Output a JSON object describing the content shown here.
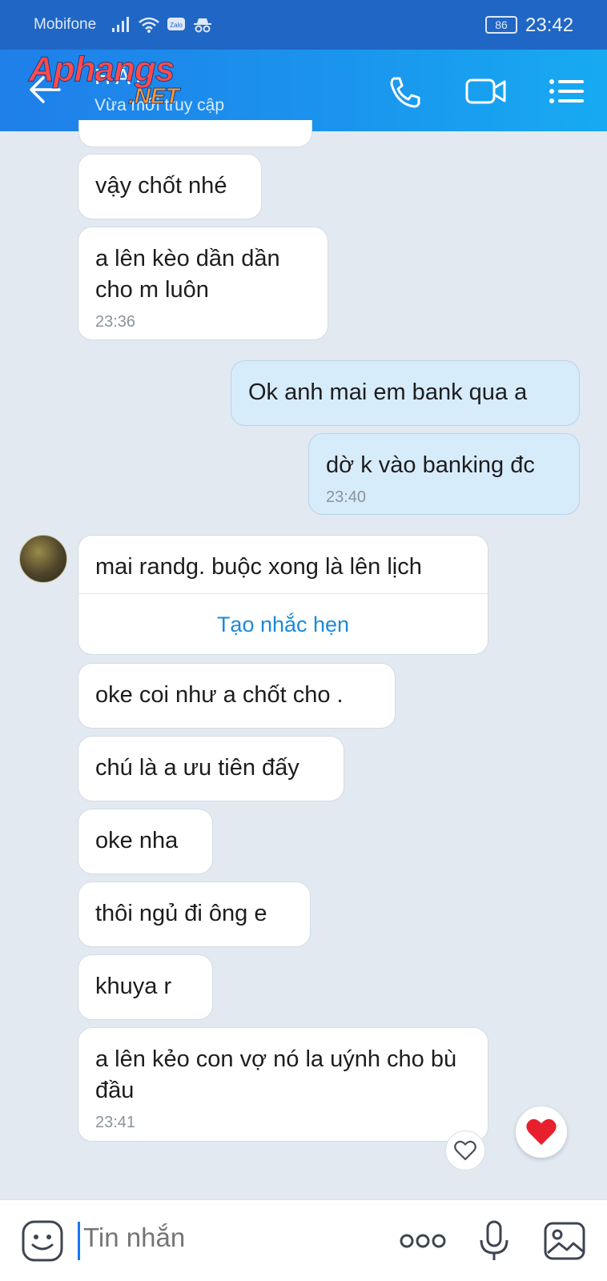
{
  "status_bar": {
    "carrier": "Mobifone",
    "battery": "86",
    "time": "23:42",
    "icons": [
      "signal-icon",
      "wifi-icon",
      "zalo-icon",
      "incognito-icon"
    ],
    "zalo_badge": "Zalo"
  },
  "header": {
    "contact_name": "HẢI",
    "status": "Vừa mới truy cập",
    "watermark": {
      "part1": "Aphangs",
      "part2": ".NET"
    },
    "icons": [
      "back-icon",
      "phone-icon",
      "video-call-icon",
      "menu-icon"
    ],
    "accent_color": "#1a96ee"
  },
  "messages": [
    {
      "id": "m1",
      "sender": "them",
      "text": "vậy chốt nhé",
      "time": ""
    },
    {
      "id": "m2",
      "sender": "them",
      "text": "a lên kèo dần dần cho m luôn",
      "time": "23:36"
    },
    {
      "id": "m3",
      "sender": "me",
      "text": "Ok anh mai em bank qua a",
      "time": ""
    },
    {
      "id": "m4",
      "sender": "me",
      "text": "dờ k vào banking đc",
      "time": "23:40"
    },
    {
      "id": "m5",
      "sender": "them",
      "text": "mai randg. buộc xong là lên lịch",
      "action": "Tạo nhắc hẹn"
    },
    {
      "id": "m6",
      "sender": "them",
      "text": "oke coi như a chốt cho ."
    },
    {
      "id": "m7",
      "sender": "them",
      "text": "chú là a ưu tiên đấy"
    },
    {
      "id": "m8",
      "sender": "them",
      "text": "oke nha"
    },
    {
      "id": "m9",
      "sender": "them",
      "text": "thôi ngủ đi ông e"
    },
    {
      "id": "m10",
      "sender": "them",
      "text": "khuya r"
    },
    {
      "id": "m11",
      "sender": "them",
      "text": "a lên kẻo con vợ nó la uýnh cho bù đầu",
      "time": "23:41"
    }
  ],
  "reactions": {
    "small": "heart-outline-icon",
    "big": "heart-icon",
    "heart_color": "#e8202e"
  },
  "input_bar": {
    "placeholder": "Tin nhắn",
    "icons": [
      "sticker-icon",
      "more-icon",
      "microphone-icon",
      "image-icon"
    ]
  },
  "colors": {
    "background": "#e2e9f1",
    "my_bubble": "#d7ecfb",
    "their_bubble": "#ffffff",
    "link": "#1c8ad8"
  }
}
